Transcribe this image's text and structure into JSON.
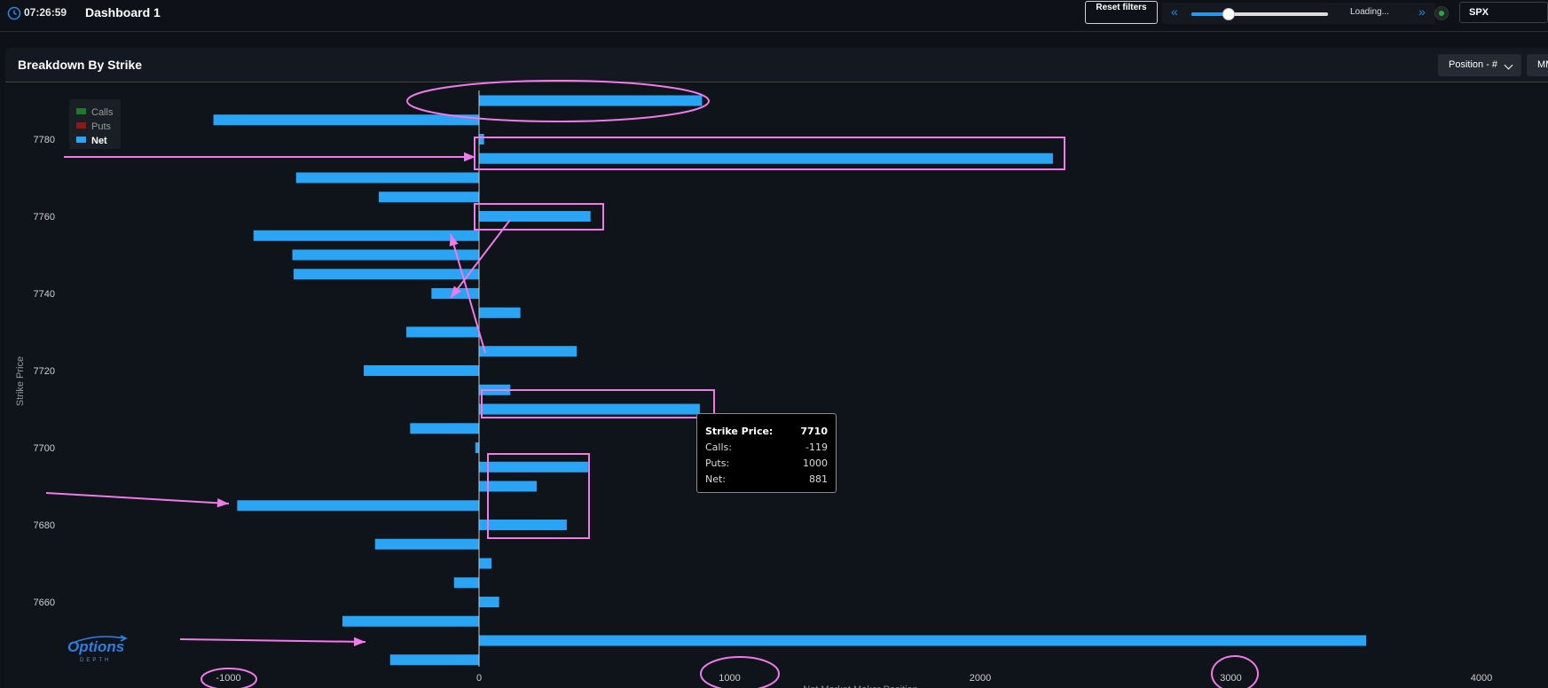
{
  "topbar": {
    "time": "07:26:59",
    "dashboard_title": "Dashboard 1",
    "reset_label": "Reset filters",
    "loading_text": "Loading...",
    "slider_fraction": 0.27,
    "symbol": "SPX",
    "nav_prev": "«",
    "nav_next": "»"
  },
  "panel": {
    "title": "Breakdown By Strike",
    "position_button": "Position - #",
    "second_button": "MM"
  },
  "logo": {
    "top": "Options",
    "sub": "DEPTH"
  },
  "colors": {
    "calls": "#1e7a26",
    "puts": "#8c1818",
    "net": "#2aa4f4",
    "annotation": "#f07ae8"
  },
  "tooltip": {
    "title_label": "Strike Price:",
    "title_value": "7710",
    "rows": [
      {
        "label": "Calls:",
        "value": "-119"
      },
      {
        "label": "Puts:",
        "value": "1000"
      },
      {
        "label": "Net:",
        "value": "881"
      }
    ]
  },
  "chart_data": {
    "type": "bar",
    "orientation": "horizontal",
    "title": "",
    "xlabel": "Net Market Maker Position",
    "ylabel": "Strike Price",
    "xlim": [
      -1880,
      4090
    ],
    "ylim": [
      7644,
      7792
    ],
    "x_ticks": [
      -1000,
      0,
      1000,
      2000,
      3000,
      4000
    ],
    "y_ticks": [
      7660,
      7680,
      7700,
      7720,
      7740,
      7760,
      7780
    ],
    "legend": {
      "position": "top-left",
      "entries": [
        {
          "name": "Calls",
          "color": "#1e7a26",
          "active": false
        },
        {
          "name": "Puts",
          "color": "#8c1818",
          "active": false
        },
        {
          "name": "Net",
          "color": "#2aa4f4",
          "active": true
        }
      ]
    },
    "series": [
      {
        "name": "Net",
        "strikes": [
          7790,
          7785,
          7780,
          7775,
          7770,
          7765,
          7760,
          7755,
          7750,
          7745,
          7740,
          7735,
          7730,
          7725,
          7720,
          7715,
          7710,
          7705,
          7700,
          7695,
          7690,
          7685,
          7680,
          7675,
          7670,
          7665,
          7660,
          7655,
          7650,
          7645
        ],
        "values": [
          890,
          -1060,
          20,
          2290,
          -730,
          -400,
          445,
          -900,
          -745,
          -740,
          -190,
          165,
          -290,
          390,
          -460,
          125,
          881,
          -275,
          -15,
          435,
          230,
          -965,
          350,
          -415,
          50,
          -100,
          80,
          -545,
          3540,
          -355
        ]
      }
    ]
  }
}
